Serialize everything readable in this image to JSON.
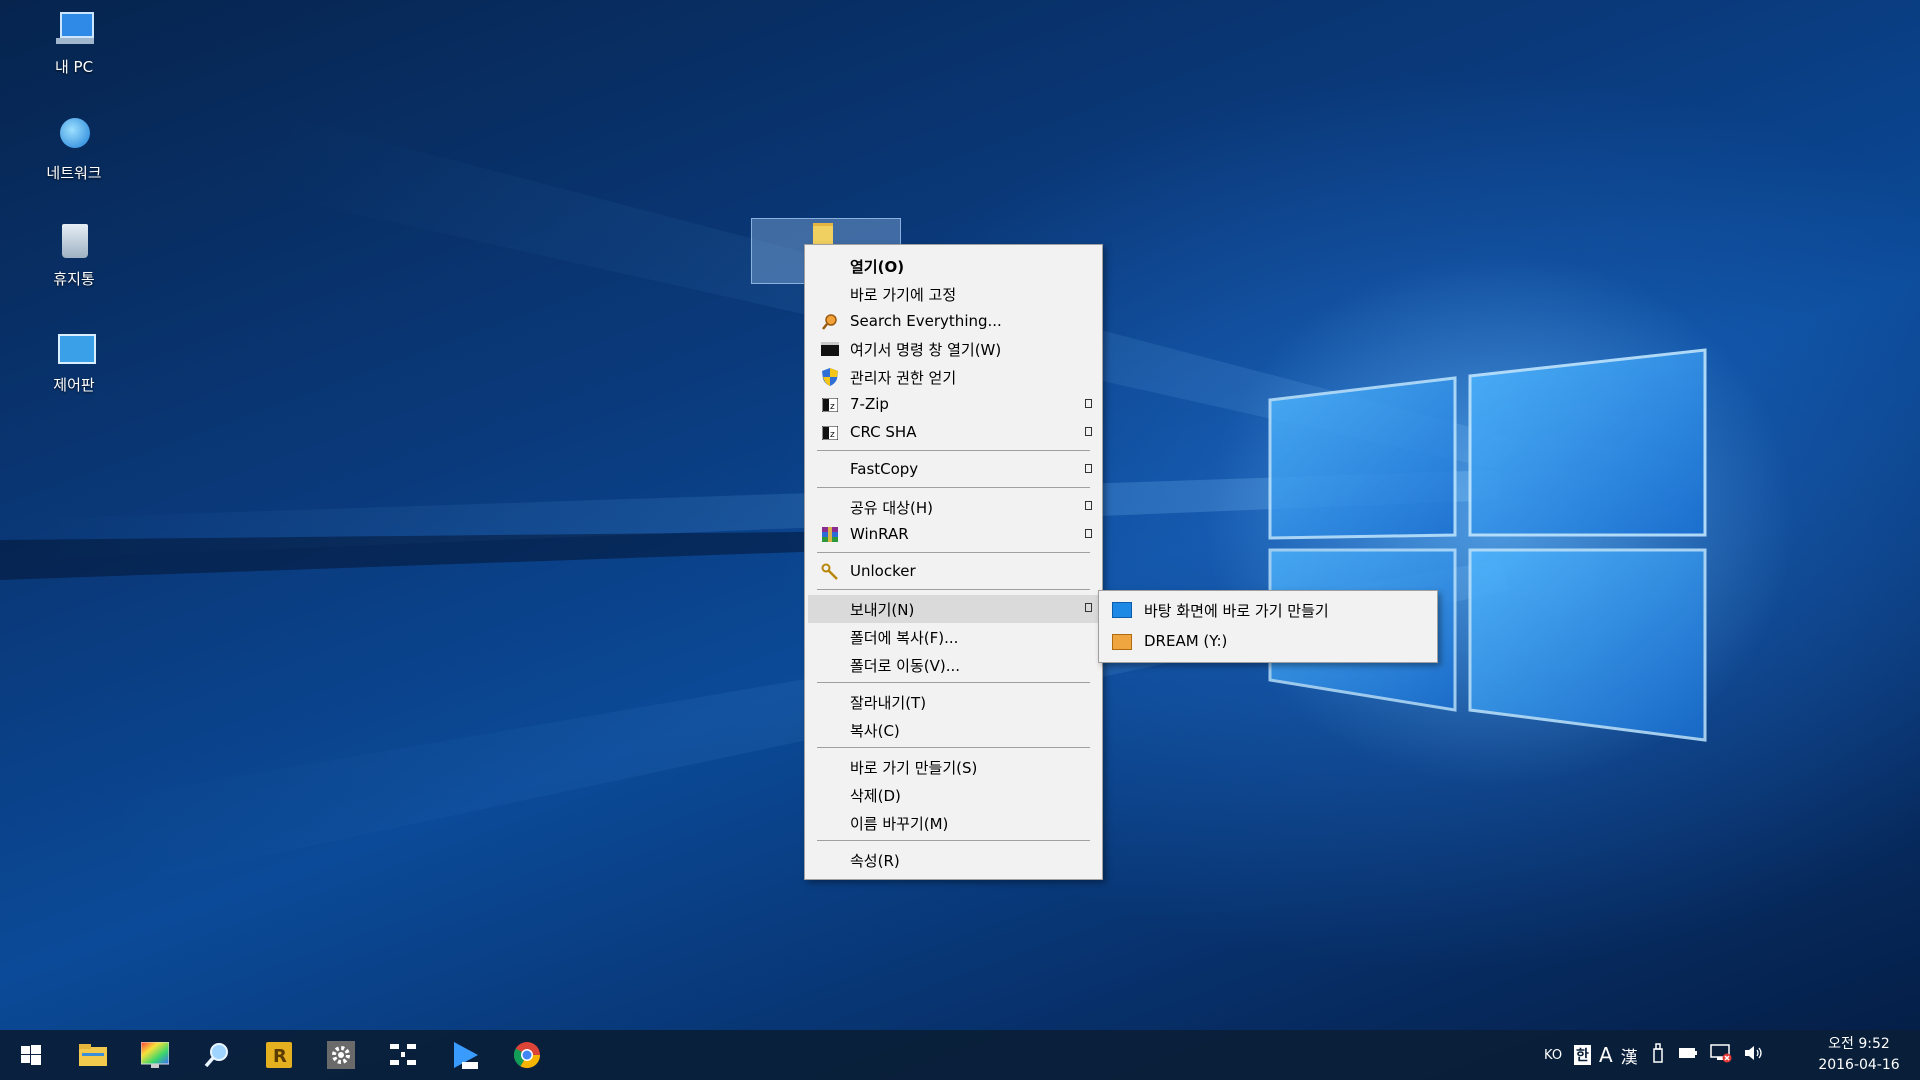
{
  "desktop": {
    "icons": [
      {
        "label": "내 PC",
        "icon": "this-pc-icon"
      },
      {
        "label": "네트워크",
        "icon": "network-icon"
      },
      {
        "label": "휴지통",
        "icon": "recycle-bin-icon"
      },
      {
        "label": "제어판",
        "icon": "control-panel-icon"
      }
    ]
  },
  "context_menu": {
    "items": [
      {
        "label": "열기(O)",
        "bold": true
      },
      {
        "label": "바로 가기에 고정"
      },
      {
        "label": "Search Everything...",
        "icon": "search-everything-icon"
      },
      {
        "label": "여기서 명령 창 열기(W)",
        "icon": "command-prompt-icon"
      },
      {
        "label": "관리자 권한 얻기",
        "icon": "uac-shield-icon"
      },
      {
        "label": "7-Zip",
        "icon": "7zip-icon",
        "submenu": true
      },
      {
        "label": "CRC SHA",
        "icon": "7zip-icon",
        "submenu": true
      },
      {
        "label": "FastCopy",
        "submenu": true
      },
      {
        "label": "공유 대상(H)",
        "submenu": true
      },
      {
        "label": "WinRAR",
        "icon": "winrar-icon",
        "submenu": true
      },
      {
        "label": "Unlocker",
        "icon": "unlocker-icon"
      },
      {
        "label": "보내기(N)",
        "submenu": true,
        "highlighted": true
      },
      {
        "label": "폴더에 복사(F)..."
      },
      {
        "label": "폴더로 이동(V)..."
      },
      {
        "label": "잘라내기(T)"
      },
      {
        "label": "복사(C)"
      },
      {
        "label": "바로 가기 만들기(S)"
      },
      {
        "label": "삭제(D)"
      },
      {
        "label": "이름 바꾸기(M)"
      },
      {
        "label": "속성(R)"
      }
    ]
  },
  "send_to_submenu": {
    "items": [
      {
        "label": "바탕 화면에 바로 가기 만들기",
        "icon": "desktop-icon"
      },
      {
        "label": "DREAM (Y:)",
        "icon": "drive-icon"
      }
    ]
  },
  "taskbar": {
    "apps": [
      "start-icon",
      "file-explorer-icon",
      "color-app-icon",
      "search-tool-icon",
      "r-app-icon",
      "settings-gear-icon",
      "grid-app-icon",
      "media-player-icon",
      "chrome-icon"
    ],
    "tray": {
      "lang": "KO",
      "ime_hangul": "한",
      "ime_a": "A",
      "ime_hanja": "漢"
    },
    "clock": {
      "time": "오전 9:52",
      "date": "2016-04-16"
    }
  },
  "colors": {
    "menu_bg": "#f2f2f2",
    "menu_highlight": "#dadada",
    "taskbar_bg": "#0a1e37",
    "selection": "#82aadc"
  }
}
